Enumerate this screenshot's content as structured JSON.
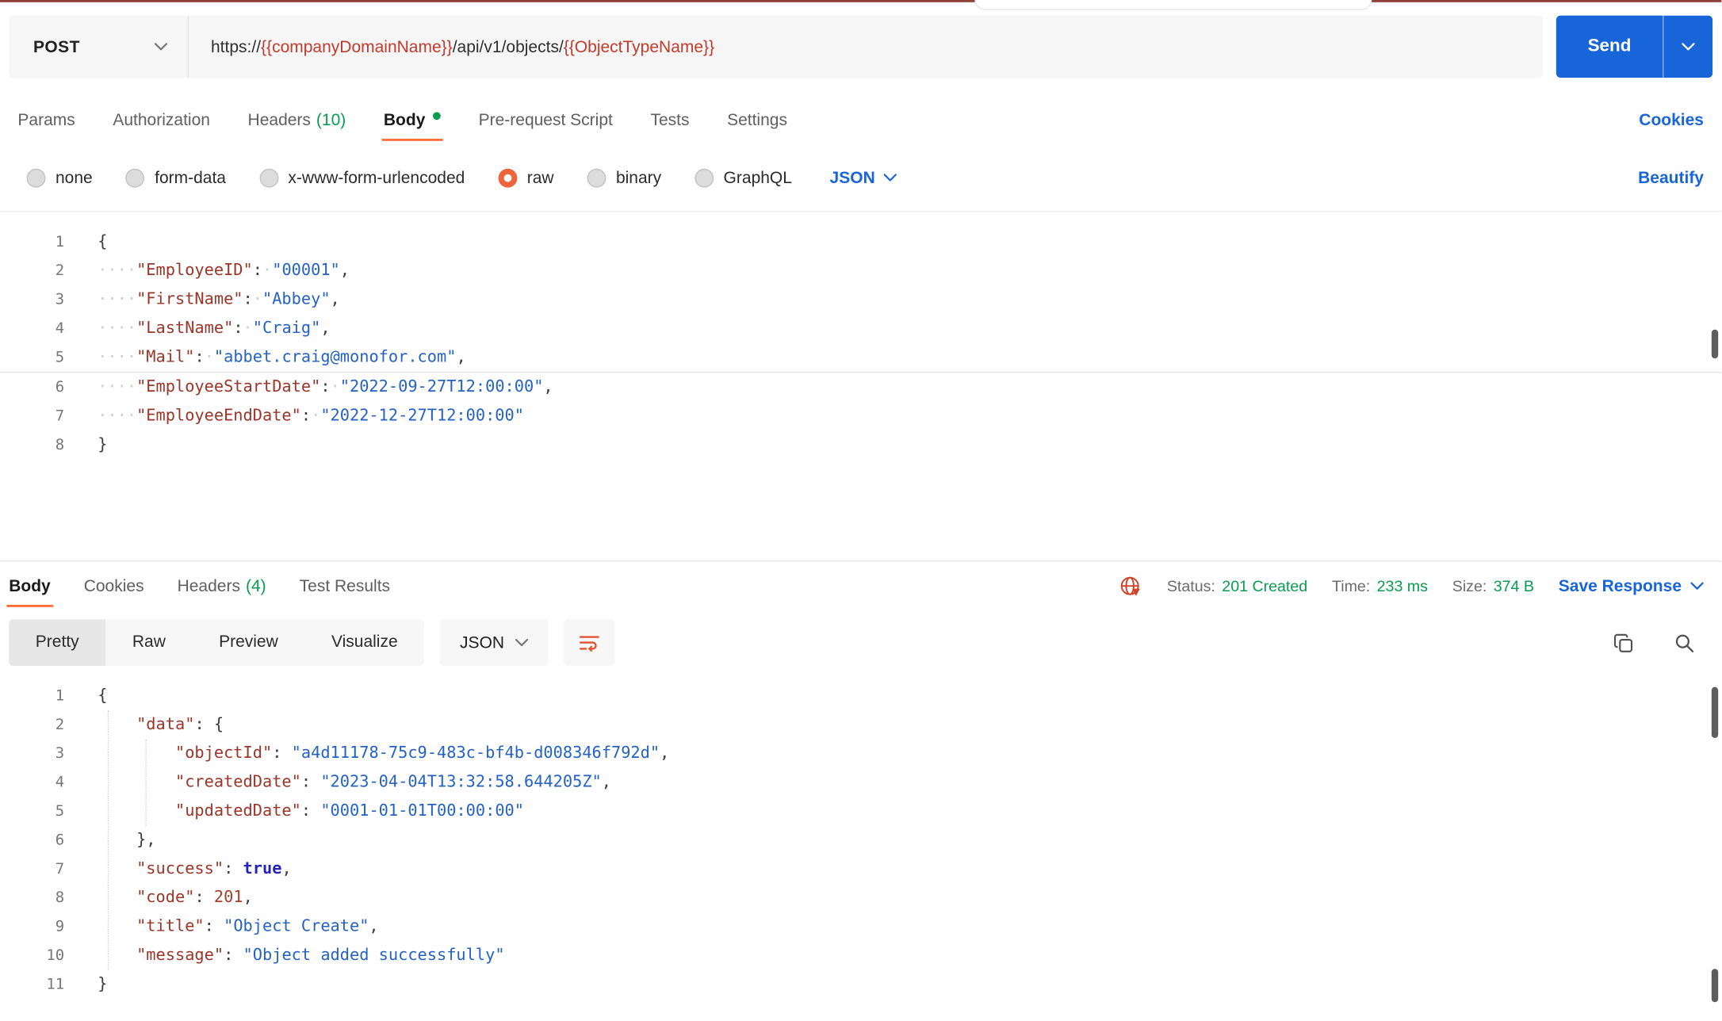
{
  "colors": {
    "accent_orange": "#FF6C37",
    "link_blue": "#1765D8",
    "send_button_blue": "#1765D8",
    "success_green": "#089E50",
    "url_variable_red": "#C13B2B",
    "json_key_color": "#9C3528",
    "json_string_color": "#2462C4"
  },
  "request": {
    "method": "POST",
    "url": {
      "parts": [
        {
          "text": "https://",
          "variable": false
        },
        {
          "text": "{{companyDomainName}}",
          "variable": true
        },
        {
          "text": "/api/v1/objects/",
          "variable": false
        },
        {
          "text": "{{ObjectTypeName}}",
          "variable": true
        }
      ]
    },
    "send_label": "Send",
    "tabs": [
      {
        "label": "Params"
      },
      {
        "label": "Authorization"
      },
      {
        "label": "Headers",
        "count": "(10)"
      },
      {
        "label": "Body",
        "active": true
      },
      {
        "label": "Pre-request Script"
      },
      {
        "label": "Tests"
      },
      {
        "label": "Settings"
      }
    ],
    "cookies_label": "Cookies",
    "modes": [
      {
        "label": "none"
      },
      {
        "label": "form-data"
      },
      {
        "label": "x-www-form-urlencoded"
      },
      {
        "label": "raw",
        "selected": true
      },
      {
        "label": "binary"
      },
      {
        "label": "GraphQL"
      }
    ],
    "language": "JSON",
    "beautify_label": "Beautify",
    "editor": {
      "active_line": 5,
      "lines": [
        [
          [
            "pun",
            "{"
          ]
        ],
        [
          [
            "ws",
            "····"
          ],
          [
            "key",
            "\"EmployeeID\""
          ],
          [
            "pun",
            ":"
          ],
          [
            "ws",
            "·"
          ],
          [
            "str",
            "\"00001\""
          ],
          [
            "pun",
            ","
          ]
        ],
        [
          [
            "ws",
            "····"
          ],
          [
            "key",
            "\"FirstName\""
          ],
          [
            "pun",
            ":"
          ],
          [
            "ws",
            "·"
          ],
          [
            "str",
            "\"Abbey\""
          ],
          [
            "pun",
            ","
          ]
        ],
        [
          [
            "ws",
            "····"
          ],
          [
            "key",
            "\"LastName\""
          ],
          [
            "pun",
            ":"
          ],
          [
            "ws",
            "·"
          ],
          [
            "str",
            "\"Craig\""
          ],
          [
            "pun",
            ","
          ]
        ],
        [
          [
            "ws",
            "····"
          ],
          [
            "key",
            "\"Mail\""
          ],
          [
            "pun",
            ":"
          ],
          [
            "ws",
            "·"
          ],
          [
            "str",
            "\"abbet.craig@monofor.com\""
          ],
          [
            "pun",
            ","
          ]
        ],
        [
          [
            "ws",
            "····"
          ],
          [
            "key",
            "\"EmployeeStartDate\""
          ],
          [
            "pun",
            ":"
          ],
          [
            "ws",
            "·"
          ],
          [
            "str",
            "\"2022-09-27T12:00:00\""
          ],
          [
            "pun",
            ","
          ]
        ],
        [
          [
            "ws",
            "····"
          ],
          [
            "key",
            "\"EmployeeEndDate\""
          ],
          [
            "pun",
            ":"
          ],
          [
            "ws",
            "·"
          ],
          [
            "str",
            "\"2022-12-27T12:00:00\""
          ]
        ],
        [
          [
            "pun",
            "}"
          ]
        ]
      ]
    }
  },
  "response": {
    "tabs": [
      {
        "label": "Body",
        "active": true
      },
      {
        "label": "Cookies"
      },
      {
        "label": "Headers",
        "count": "(4)"
      },
      {
        "label": "Test Results"
      }
    ],
    "meta": {
      "status_label": "Status:",
      "status_value": "201 Created",
      "time_label": "Time:",
      "time_value": "233 ms",
      "size_label": "Size:",
      "size_value": "374 B"
    },
    "save_label": "Save Response",
    "view_tabs": [
      {
        "label": "Pretty",
        "active": true
      },
      {
        "label": "Raw"
      },
      {
        "label": "Preview"
      },
      {
        "label": "Visualize"
      }
    ],
    "language": "JSON",
    "editor": {
      "lines": [
        [
          [
            "pun",
            "{"
          ]
        ],
        [
          [
            "pun",
            "    "
          ],
          [
            "key",
            "\"data\""
          ],
          [
            "pun",
            ": {"
          ]
        ],
        [
          [
            "pun",
            "        "
          ],
          [
            "key",
            "\"objectId\""
          ],
          [
            "pun",
            ": "
          ],
          [
            "str",
            "\"a4d11178-75c9-483c-bf4b-d008346f792d\""
          ],
          [
            "pun",
            ","
          ]
        ],
        [
          [
            "pun",
            "        "
          ],
          [
            "key",
            "\"createdDate\""
          ],
          [
            "pun",
            ": "
          ],
          [
            "str",
            "\"2023-04-04T13:32:58.644205Z\""
          ],
          [
            "pun",
            ","
          ]
        ],
        [
          [
            "pun",
            "        "
          ],
          [
            "key",
            "\"updatedDate\""
          ],
          [
            "pun",
            ": "
          ],
          [
            "str",
            "\"0001-01-01T00:00:00\""
          ]
        ],
        [
          [
            "pun",
            "    },"
          ]
        ],
        [
          [
            "pun",
            "    "
          ],
          [
            "key",
            "\"success\""
          ],
          [
            "pun",
            ": "
          ],
          [
            "bool",
            "true"
          ],
          [
            "pun",
            ","
          ]
        ],
        [
          [
            "pun",
            "    "
          ],
          [
            "key",
            "\"code\""
          ],
          [
            "pun",
            ": "
          ],
          [
            "num",
            "201"
          ],
          [
            "pun",
            ","
          ]
        ],
        [
          [
            "pun",
            "    "
          ],
          [
            "key",
            "\"title\""
          ],
          [
            "pun",
            ": "
          ],
          [
            "str",
            "\"Object Create\""
          ],
          [
            "pun",
            ","
          ]
        ],
        [
          [
            "pun",
            "    "
          ],
          [
            "key",
            "\"message\""
          ],
          [
            "pun",
            ": "
          ],
          [
            "str",
            "\"Object added successfully\""
          ]
        ],
        [
          [
            "pun",
            "}"
          ]
        ]
      ]
    }
  }
}
